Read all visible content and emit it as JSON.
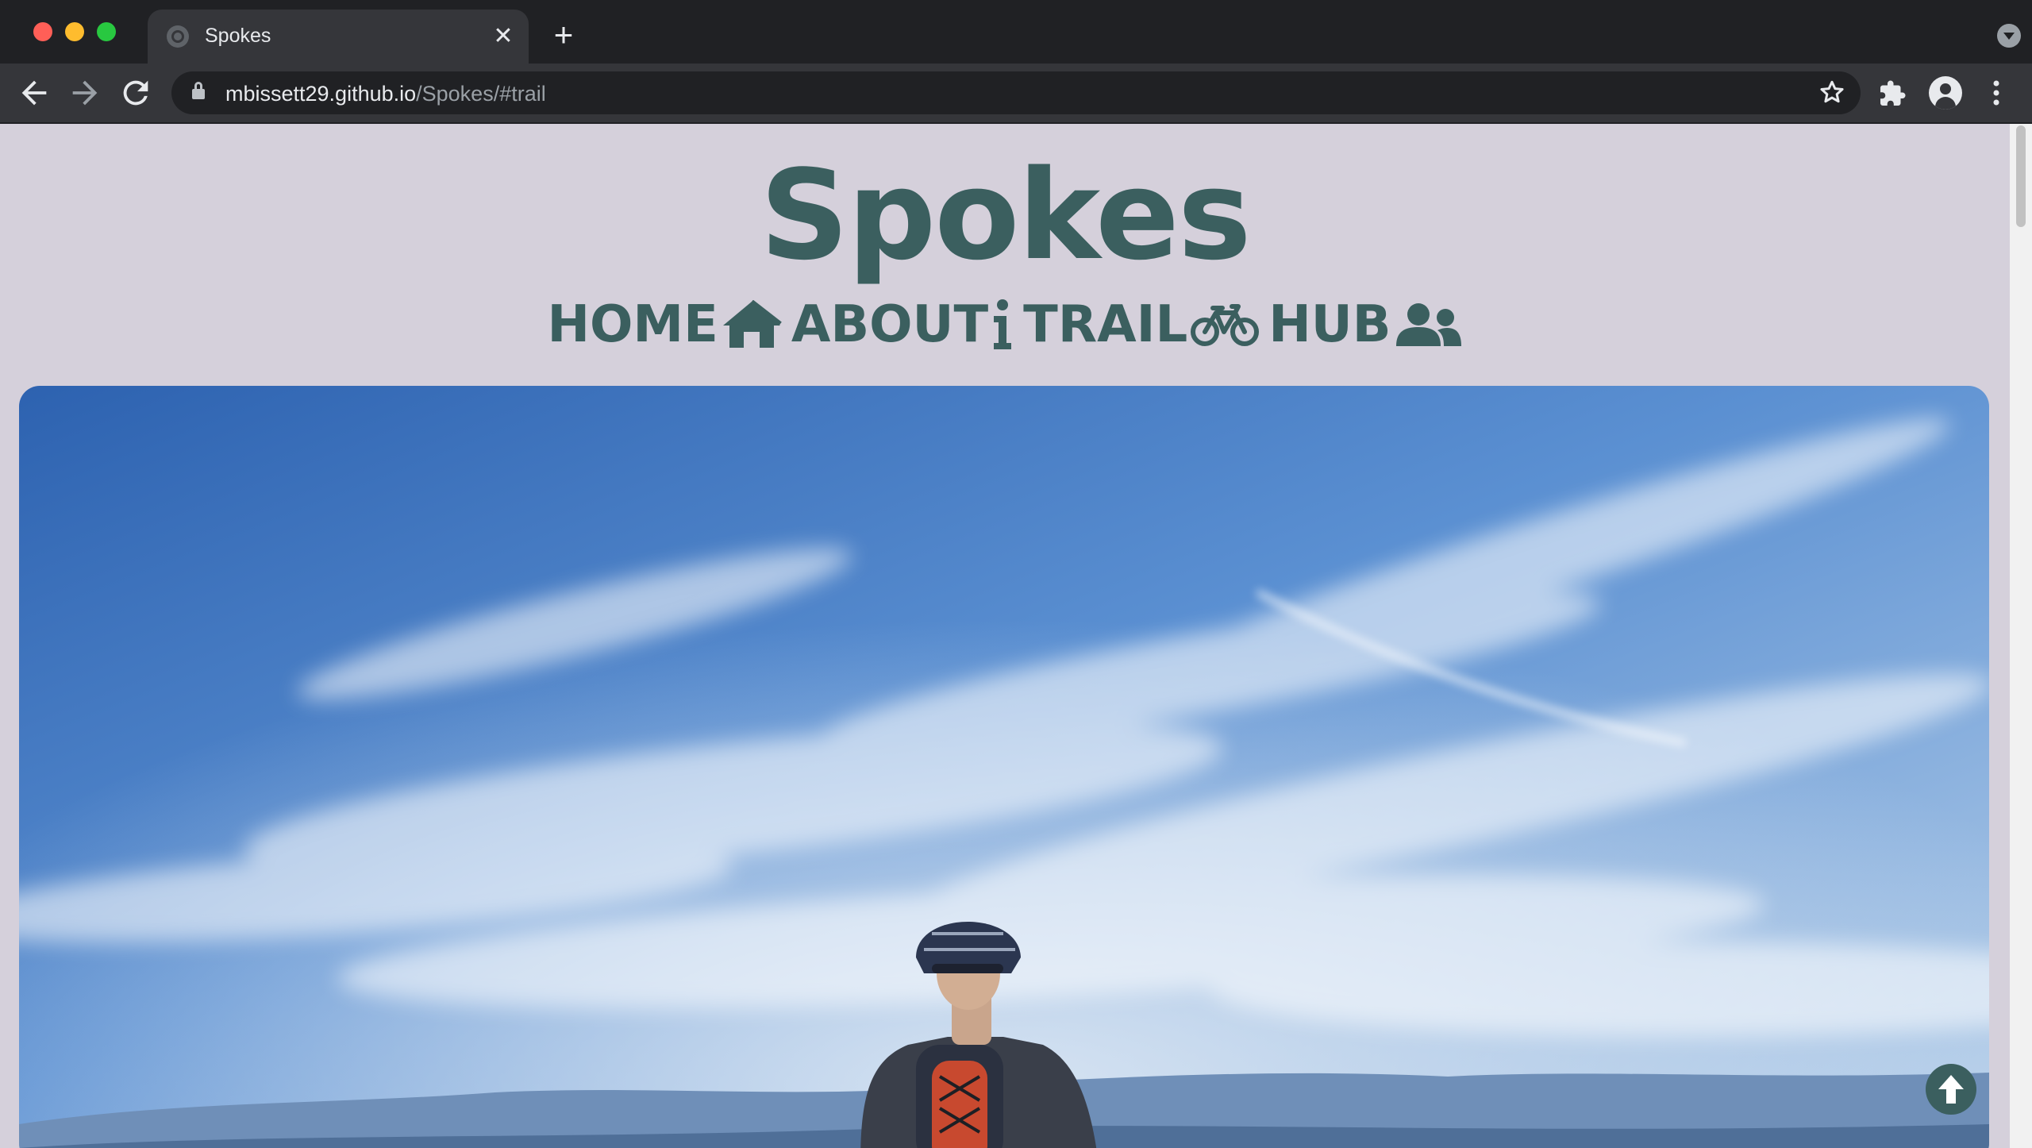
{
  "browser": {
    "tab_title": "Spokes",
    "tab_close": "✕",
    "new_tab": "+",
    "url_host": "mbissett29.github.io",
    "url_path": "/Spokes/#trail",
    "icons": [
      "back-arrow-icon",
      "forward-arrow-icon",
      "reload-icon",
      "lock-icon",
      "star-icon",
      "extensions-icon",
      "profile-icon",
      "menu-icon"
    ]
  },
  "page": {
    "title": "Spokes",
    "nav": [
      {
        "label": "HOME",
        "icon": "house-icon"
      },
      {
        "label": "ABOUT",
        "icon": "info-icon"
      },
      {
        "label": "TRAIL",
        "icon": "bicycle-icon"
      },
      {
        "label": "HUB",
        "icon": "users-icon"
      }
    ],
    "hero_image": "cyclist-on-mountain-top",
    "back_to_top_icon": "arrow-up-circle-icon"
  },
  "colors": {
    "page_bg": "#d5d0db",
    "brand": "#3b5f5f",
    "chrome_dark": "#202124",
    "chrome_toolbar": "#35363a"
  }
}
